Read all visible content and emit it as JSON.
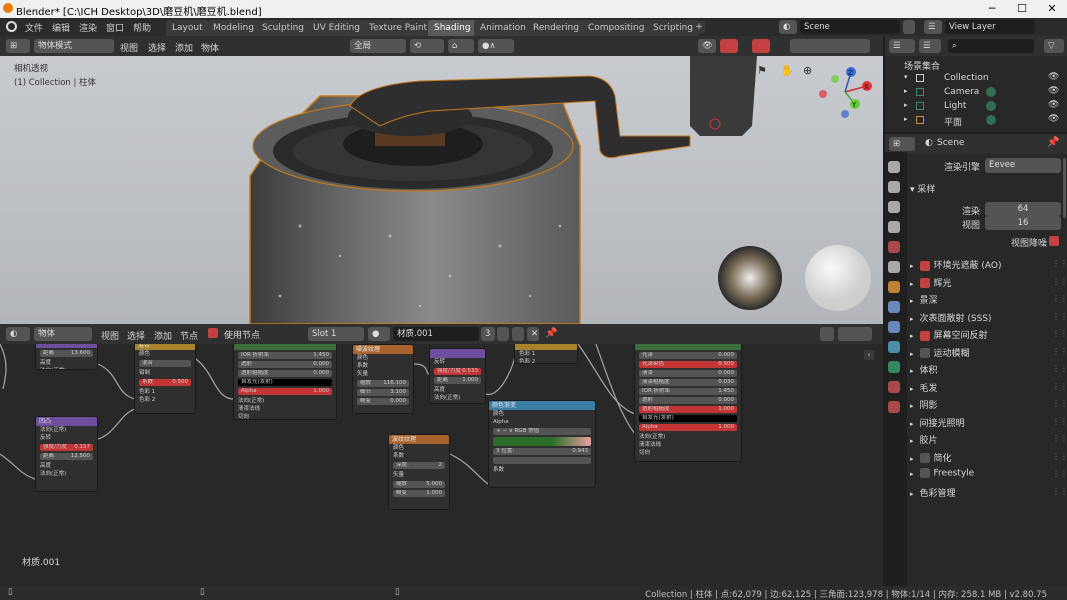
{
  "window": {
    "title": "Blender* [C:\\ICH Desktop\\3D\\磨豆机\\磨豆机.blend]",
    "minimize": "─",
    "maximize": "☐",
    "close": "✕"
  },
  "menu": [
    "文件",
    "编辑",
    "渲染",
    "窗口",
    "帮助"
  ],
  "workspaces": [
    "Layout",
    "Modeling",
    "Sculpting",
    "UV Editing",
    "Texture Paint",
    "Shading",
    "Animation",
    "Rendering",
    "Compositing",
    "Scripting"
  ],
  "active_workspace": "Shading",
  "scene": {
    "name": "Scene",
    "view_layer": "View Layer"
  },
  "viewport": {
    "mode": "物体模式",
    "menus": [
      "视图",
      "选择",
      "添加",
      "物体"
    ],
    "orientation": "全局",
    "overlay_title": "相机透视",
    "overlay_sub": "(1) Collection | 柱体",
    "axes": [
      "X",
      "Y",
      "Z"
    ]
  },
  "node_editor": {
    "type": "物体",
    "menus": [
      "视图",
      "选择",
      "添加",
      "节点"
    ],
    "use_nodes_label": "使用节点",
    "slot": "Slot 1",
    "material": "材质.001",
    "users": "3",
    "footer_label": "材质.001"
  },
  "nodes": [
    {
      "id": "n1",
      "title": "",
      "color": "#6e4f9e",
      "rows": [
        {
          "t": "field",
          "text": "距离",
          "val": "13.600"
        },
        {
          "t": "label",
          "text": "高度"
        },
        {
          "t": "label",
          "text": "法向(正常)"
        }
      ]
    },
    {
      "id": "n2",
      "title": "混合",
      "color": "#a8832e",
      "rows": [
        {
          "t": "label",
          "text": "颜色"
        },
        {
          "t": "field",
          "text": "混合"
        },
        {
          "t": "label",
          "text": "钳制"
        },
        {
          "t": "field",
          "text": "系数",
          "val": "0.500",
          "red": true
        },
        {
          "t": "label",
          "text": "色彩 1"
        },
        {
          "t": "label",
          "text": "色彩 2"
        }
      ]
    },
    {
      "id": "n3",
      "title": "",
      "color": "#3c6e3c",
      "rows": [
        {
          "t": "field",
          "text": "IOR 折射率",
          "val": "1.450"
        },
        {
          "t": "field",
          "text": "透射",
          "val": "0.000"
        },
        {
          "t": "field",
          "text": "透射粗糙度",
          "val": "0.000"
        },
        {
          "t": "field",
          "text": "自发光(发射)",
          "black": true
        },
        {
          "t": "field",
          "text": "Alpha",
          "val": "1.000",
          "red": true
        },
        {
          "t": "label",
          "text": "法向(正常)"
        },
        {
          "t": "label",
          "text": "清漆法线"
        },
        {
          "t": "label",
          "text": "切向"
        }
      ]
    },
    {
      "id": "n4",
      "title": "噪波纹理",
      "color": "#a8632e",
      "rows": [
        {
          "t": "label",
          "text": "颜色"
        },
        {
          "t": "label",
          "text": "系数"
        },
        {
          "t": "label",
          "text": "矢量"
        },
        {
          "t": "field",
          "text": "缩放",
          "val": "116.100"
        },
        {
          "t": "field",
          "text": "细节",
          "val": "3.100"
        },
        {
          "t": "field",
          "text": "畸变",
          "val": "0.000"
        }
      ]
    },
    {
      "id": "n5",
      "title": "",
      "color": "#6e4f9e",
      "rows": [
        {
          "t": "label",
          "text": "反转"
        },
        {
          "t": "field",
          "text": "强度/力度",
          "val": "0.533",
          "red": true
        },
        {
          "t": "field",
          "text": "距离",
          "val": "1.000"
        },
        {
          "t": "label",
          "text": "高度"
        },
        {
          "t": "label",
          "text": "法向(正常)"
        }
      ]
    },
    {
      "id": "n6",
      "title": "",
      "color": "#a8832e",
      "rows": [
        {
          "t": "label",
          "text": "色彩 1"
        },
        {
          "t": "label",
          "text": "色彩 2"
        }
      ]
    },
    {
      "id": "n7",
      "title": "",
      "color": "#3c6e3c",
      "rows": [
        {
          "t": "field",
          "text": "光泽",
          "val": "0.000"
        },
        {
          "t": "field",
          "text": "光泽染色",
          "val": "0.500",
          "red": true
        },
        {
          "t": "field",
          "text": "清漆",
          "val": "0.000"
        },
        {
          "t": "field",
          "text": "清漆粗糙度",
          "val": "0.030"
        },
        {
          "t": "field",
          "text": "IOR 折射率",
          "val": "1.450"
        },
        {
          "t": "field",
          "text": "透射",
          "val": "0.000"
        },
        {
          "t": "field",
          "text": "透射粗糙度",
          "val": "1.000",
          "red": true
        },
        {
          "t": "field",
          "text": "自发光(发射)",
          "black": true
        },
        {
          "t": "field",
          "text": "Alpha",
          "val": "1.000",
          "red": true
        },
        {
          "t": "label",
          "text": "法向(正常)"
        },
        {
          "t": "label",
          "text": "清漆法线"
        },
        {
          "t": "label",
          "text": "切向"
        }
      ]
    },
    {
      "id": "n8",
      "title": "凹凸",
      "color": "#6e4f9e",
      "rows": [
        {
          "t": "label",
          "text": "法向(正常)"
        },
        {
          "t": "label",
          "text": "反转"
        },
        {
          "t": "field",
          "text": "强度/力度",
          "val": "0.157",
          "red": true
        },
        {
          "t": "field",
          "text": "距离",
          "val": "12.500"
        },
        {
          "t": "label",
          "text": "高度"
        },
        {
          "t": "label",
          "text": "法向(正常)"
        }
      ]
    },
    {
      "id": "n9",
      "title": "颜色渐变",
      "color": "#3d7ea6",
      "rows": [
        {
          "t": "label",
          "text": "颜色"
        },
        {
          "t": "label",
          "text": "Alpha"
        },
        {
          "t": "field",
          "text": "+ − ∨  RGB  常值"
        },
        {
          "t": "ramp"
        },
        {
          "t": "field",
          "text": "3        位置:",
          "val": "0.943"
        },
        {
          "t": "field",
          "text": ""
        },
        {
          "t": "label",
          "text": "系数"
        }
      ]
    },
    {
      "id": "n10",
      "title": "波纹纹理",
      "color": "#a8632e",
      "rows": [
        {
          "t": "label",
          "text": "颜色"
        },
        {
          "t": "label",
          "text": "系数"
        },
        {
          "t": "field",
          "text": "深度:",
          "val": "2"
        },
        {
          "t": "label",
          "text": "矢量"
        },
        {
          "t": "field",
          "text": "缩放",
          "val": "5.000"
        },
        {
          "t": "field",
          "text": "畸变",
          "val": "1.000"
        }
      ]
    }
  ],
  "outliner": {
    "root": "场景集合",
    "items": [
      {
        "name": "Collection",
        "icon": "collection-icon"
      },
      {
        "name": "Camera",
        "icon": "camera-icon"
      },
      {
        "name": "Light",
        "icon": "light-icon"
      },
      {
        "name": "平面",
        "icon": "mesh-icon"
      }
    ]
  },
  "properties": {
    "scene_name": "Scene",
    "render_engine_label": "渲染引擎",
    "render_engine": "Eevee",
    "sampling": "采样",
    "render_label": "渲染",
    "render_samples": "64",
    "viewport_label": "视图",
    "viewport_samples": "16",
    "viewport_denoise": "视图降噪",
    "sections": [
      {
        "label": "环境光遮蔽 (AO)",
        "check": "on"
      },
      {
        "label": "辉光",
        "check": "on"
      },
      {
        "label": "景深",
        "check": "none"
      },
      {
        "label": "次表面散射 (SSS)",
        "check": "none"
      },
      {
        "label": "屏幕空间反射",
        "check": "on"
      },
      {
        "label": "运动模糊",
        "check": "off"
      },
      {
        "label": "体积",
        "check": "none"
      },
      {
        "label": "毛发",
        "check": "none"
      },
      {
        "label": "阴影",
        "check": "none"
      },
      {
        "label": "间接光照明",
        "check": "none"
      },
      {
        "label": "胶片",
        "check": "none"
      },
      {
        "label": "简化",
        "check": "off"
      },
      {
        "label": "Freestyle",
        "check": "off"
      },
      {
        "label": "色彩管理",
        "check": "none"
      }
    ]
  },
  "status": "Collection | 柱体 | 点:62,079 | 边:62,125 | 三角面:123,978 | 物体:1/14 | 内存: 258.1 MB | v2.80.75",
  "colors": {
    "accent_red": "#c34141",
    "header": "#303030",
    "panel": "#282828"
  }
}
